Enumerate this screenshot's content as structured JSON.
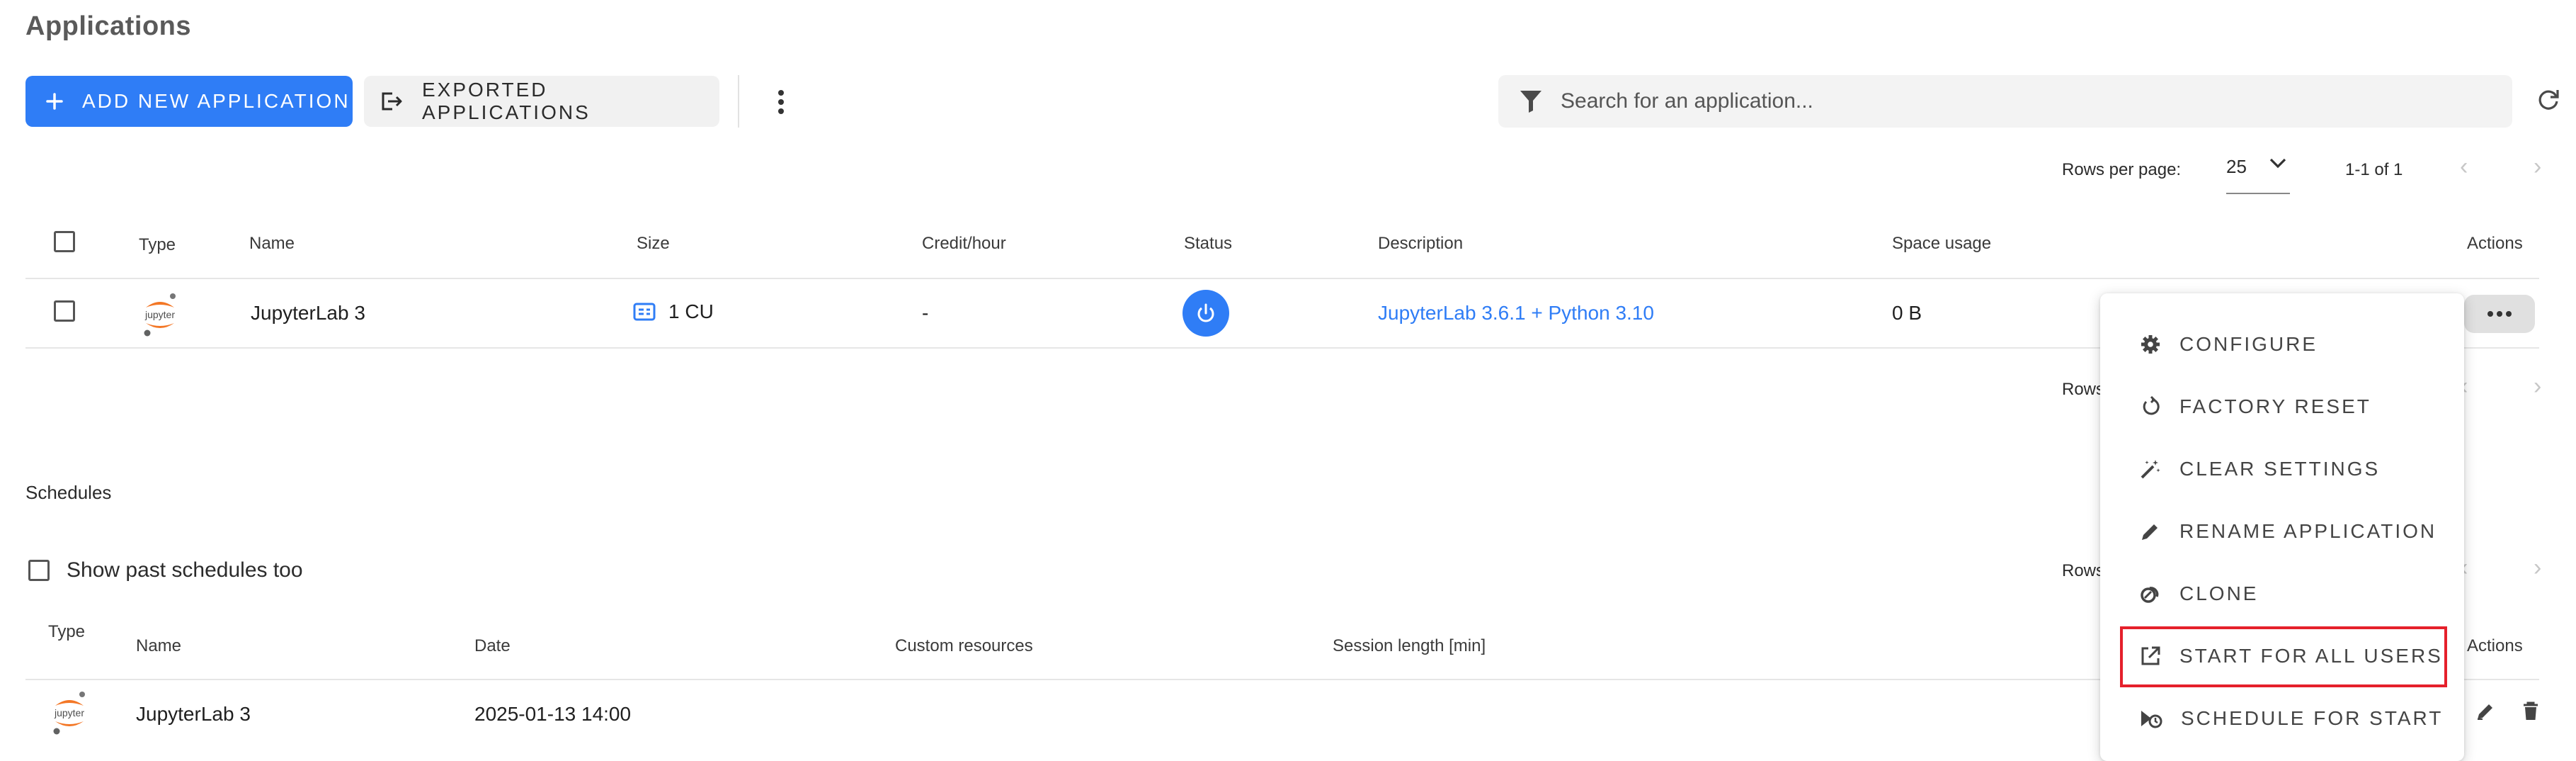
{
  "page": {
    "title": "Applications"
  },
  "toolbar": {
    "add_label": "ADD NEW APPLICATION",
    "exported_label": "EXPORTED APPLICATIONS",
    "search_placeholder": "Search for an application..."
  },
  "pagination": {
    "rows_per_page_label": "Rows per page:",
    "rows_per_page_value": "25",
    "range": "1-1 of 1",
    "rows_truncated": "Rows"
  },
  "apps_table": {
    "headers": {
      "type": "Type",
      "name": "Name",
      "size": "Size",
      "credit": "Credit/hour",
      "status": "Status",
      "description": "Description",
      "space": "Space usage",
      "actions": "Actions"
    },
    "rows": [
      {
        "logo_text": "jupyter",
        "name": "JupyterLab 3",
        "size": "1 CU",
        "credit": "-",
        "description": "JupyterLab 3.6.1 + Python 3.10",
        "space": "0 B"
      }
    ]
  },
  "schedules": {
    "title": "Schedules",
    "show_past_label": "Show past schedules too",
    "headers": {
      "type": "Type",
      "name": "Name",
      "date": "Date",
      "custom": "Custom resources",
      "session": "Session length [min]",
      "actions": "Actions"
    },
    "rows": [
      {
        "logo_text": "jupyter",
        "name": "JupyterLab 3",
        "date": "2025-01-13 14:00"
      }
    ]
  },
  "context_menu": {
    "items": [
      {
        "label": "CONFIGURE",
        "icon": "gear-icon"
      },
      {
        "label": "FACTORY RESET",
        "icon": "restart-icon"
      },
      {
        "label": "CLEAR SETTINGS",
        "icon": "magic-wand-icon"
      },
      {
        "label": "RENAME APPLICATION",
        "icon": "pencil-icon"
      },
      {
        "label": "CLONE",
        "icon": "clone-icon"
      },
      {
        "label": "START FOR ALL USERS",
        "icon": "open-external-icon",
        "highlighted": true
      },
      {
        "label": "SCHEDULE FOR START",
        "icon": "schedule-icon"
      }
    ]
  },
  "colors": {
    "primary": "#2f7df6",
    "highlight_border": "#e5202b",
    "jupyter_orange": "#f37726"
  }
}
